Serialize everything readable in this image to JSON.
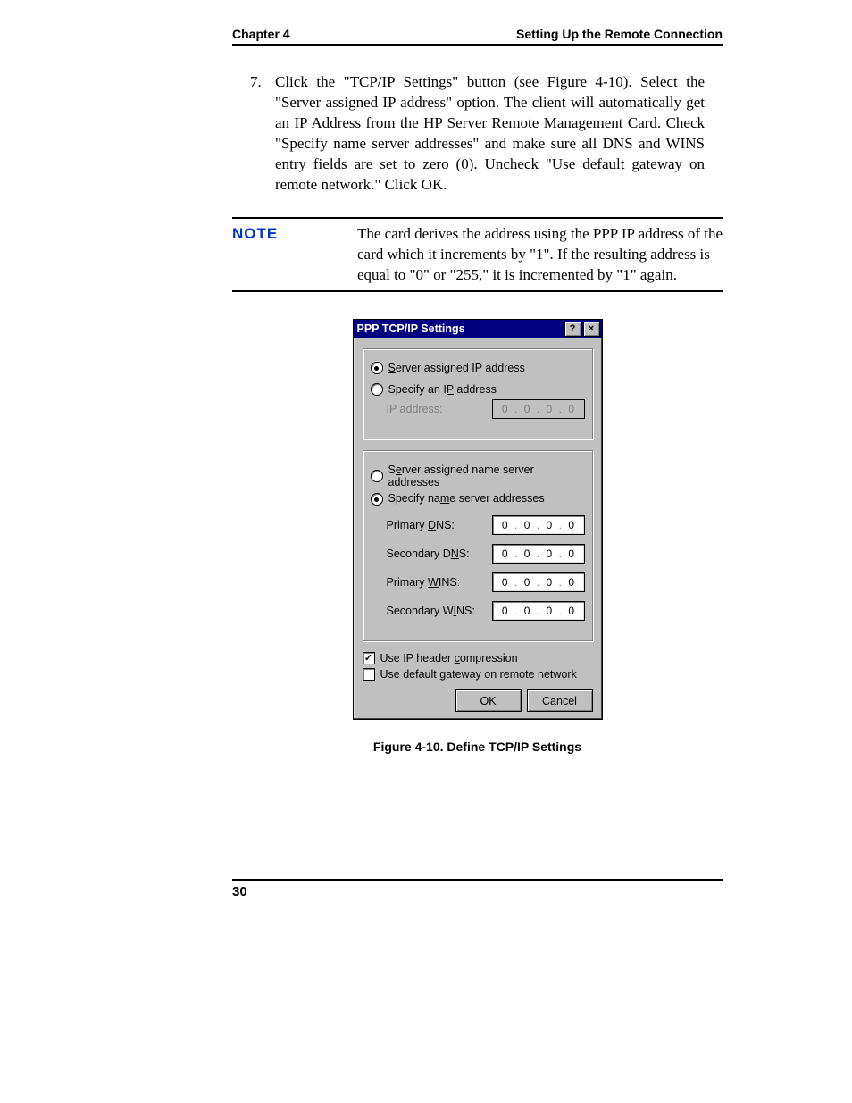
{
  "header": {
    "left": "Chapter 4",
    "right": "Setting Up the Remote Connection"
  },
  "step": {
    "num": "7.",
    "text": "Click the \"TCP/IP Settings\" button (see Figure 4-10). Select the \"Server assigned IP address\" option. The client will automatically get an IP Address from the HP Server Remote Management Card. Check \"Specify name server addresses\" and make sure all DNS and WINS entry fields are set to zero (0). Uncheck \"Use default gateway on remote network.\" Click OK."
  },
  "note": {
    "label": "NOTE",
    "text": "The card derives the address using the PPP IP address of the card which it increments by \"1\". If the resulting address is equal to \"0\" or \"255,\" it is incremented by \"1\" again."
  },
  "dialog": {
    "title": "PPP TCP/IP Settings",
    "help_btn": "?",
    "close_btn": "×",
    "radio_server_ip": {
      "pre": "S",
      "rest": "erver assigned IP address",
      "selected": true
    },
    "radio_specify_ip": {
      "pre": "Specify an I",
      "hot": "P",
      "rest": " address",
      "selected": false
    },
    "ip_addr_label": "IP address:",
    "ip_addr_value": [
      "0",
      "0",
      "0",
      "0"
    ],
    "radio_server_ns": {
      "pre": "S",
      "hot": "e",
      "rest": "rver assigned name server addresses",
      "selected": false
    },
    "radio_specify_ns": {
      "pre": "Specify na",
      "hot": "m",
      "rest": "e server addresses",
      "selected": true
    },
    "dns1_label_pre": "Primary ",
    "dns1_hot": "D",
    "dns1_rest": "NS:",
    "dns2_label_pre": "Secondary D",
    "dns2_hot": "N",
    "dns2_rest": "S:",
    "wins1_label_pre": "Primary ",
    "wins1_hot": "W",
    "wins1_rest": "INS:",
    "wins2_label_pre": "Secondary W",
    "wins2_hot": "I",
    "wins2_rest": "NS:",
    "dns1": [
      "0",
      "0",
      "0",
      "0"
    ],
    "dns2": [
      "0",
      "0",
      "0",
      "0"
    ],
    "wins1": [
      "0",
      "0",
      "0",
      "0"
    ],
    "wins2": [
      "0",
      "0",
      "0",
      "0"
    ],
    "chk_compression": {
      "pre": "Use IP header ",
      "hot": "c",
      "rest": "ompression",
      "checked": true
    },
    "chk_gateway": {
      "pre": "Use default ",
      "hot": "g",
      "rest": "ateway on remote network",
      "checked": false
    },
    "ok": "OK",
    "cancel": "Cancel"
  },
  "caption": "Figure 4-10.  Define TCP/IP Settings",
  "page_number": "30"
}
